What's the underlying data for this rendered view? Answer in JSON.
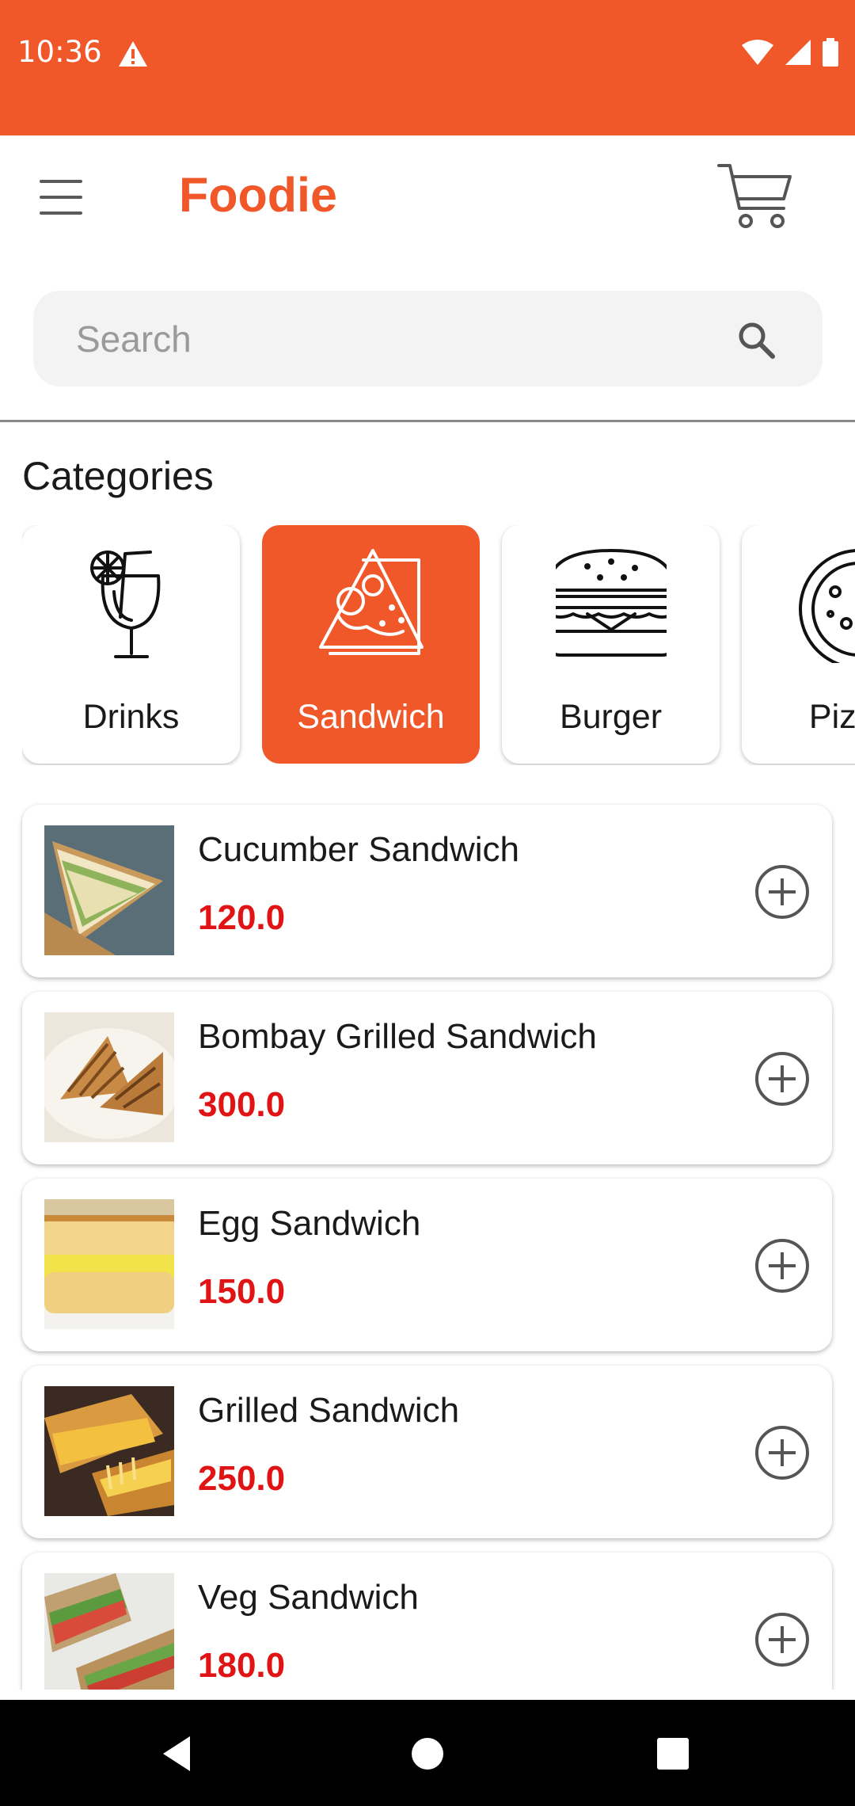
{
  "status_bar": {
    "time": "10:36",
    "icons": [
      "warning-icon",
      "wifi-icon",
      "signal-icon",
      "battery-icon"
    ]
  },
  "toolbar": {
    "title": "Foodie",
    "menu_icon": "hamburger-menu-icon",
    "cart_icon": "shopping-cart-icon"
  },
  "search": {
    "placeholder": "Search",
    "value": "",
    "icon": "search-icon"
  },
  "categories": {
    "title": "Categories",
    "items": [
      {
        "label": "Drinks",
        "icon": "drink-icon",
        "selected": false
      },
      {
        "label": "Sandwich",
        "icon": "sandwich-icon",
        "selected": true
      },
      {
        "label": "Burger",
        "icon": "burger-icon",
        "selected": false
      },
      {
        "label": "Pizza",
        "icon": "pizza-icon",
        "selected": false
      }
    ]
  },
  "products": [
    {
      "name": "Cucumber Sandwich",
      "price": "120.0"
    },
    {
      "name": "Bombay Grilled Sandwich",
      "price": "300.0"
    },
    {
      "name": "Egg Sandwich",
      "price": "150.0"
    },
    {
      "name": "Grilled Sandwich",
      "price": "250.0"
    },
    {
      "name": "Veg Sandwich",
      "price": "180.0"
    }
  ],
  "colors": {
    "brand": "#F0582A",
    "price": "#E01414",
    "navbar": "#000000"
  },
  "nav_bar": {
    "icons": [
      "back-icon",
      "home-icon",
      "recents-icon"
    ]
  }
}
